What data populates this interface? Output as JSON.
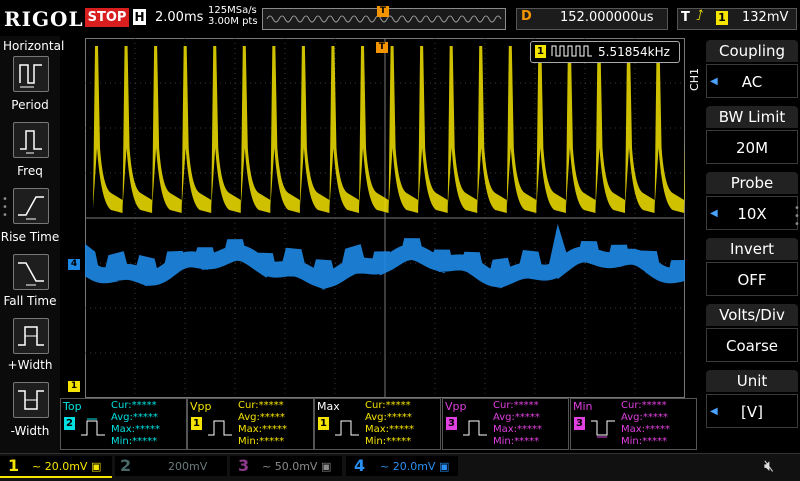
{
  "top": {
    "logo": "RIGOL",
    "status": "STOP",
    "h_badge": "H",
    "timebase": "2.00ms",
    "sample_rate": "125MSa/s",
    "mem_depth": "3.00M pts",
    "trigger_marker": "T",
    "d_badge": "D",
    "delay": "152.000000us",
    "t_badge": "T",
    "trigger_source": "1",
    "trigger_level": "132mV"
  },
  "left_panel": {
    "title": "Horizontal",
    "items": [
      {
        "label": "Period",
        "icon": "period-icon"
      },
      {
        "label": "Freq",
        "icon": "freq-icon"
      },
      {
        "label": "Rise Time",
        "icon": "rise-time-icon"
      },
      {
        "label": "Fall Time",
        "icon": "fall-time-icon"
      },
      {
        "label": "+Width",
        "icon": "plus-width-icon"
      },
      {
        "label": "-Width",
        "icon": "minus-width-icon"
      }
    ]
  },
  "right_menu": {
    "channel_label": "CH1",
    "items": [
      {
        "title": "Coupling",
        "value": "AC"
      },
      {
        "title": "BW Limit",
        "value": "20M"
      },
      {
        "title": "Probe",
        "value": "10X"
      },
      {
        "title": "Invert",
        "value": "OFF"
      },
      {
        "title": "Volts/Div",
        "value": "Coarse"
      },
      {
        "title": "Unit",
        "value": "[V]"
      }
    ]
  },
  "freq_counter": {
    "channel": "1",
    "value": "5.51854kHz"
  },
  "markers": {
    "ch4": "4",
    "ch1": "1",
    "trig": "T"
  },
  "measurements": [
    {
      "name": "Top",
      "channel": "2",
      "color": "#00e0e0",
      "cur": "Cur:*****",
      "avg": "Avg:*****",
      "max": "Max:*****",
      "min": "Min:*****"
    },
    {
      "name": "Vpp",
      "channel": "1",
      "color": "#f5e300",
      "cur": "Cur:*****",
      "avg": "Avg:*****",
      "max": "Max:*****",
      "min": "Min:*****"
    },
    {
      "name": "Max",
      "channel": "1",
      "color": "#f5e300",
      "cur": "Cur:*****",
      "avg": "Avg:*****",
      "max": "Max:*****",
      "min": "Min:*****"
    },
    {
      "name": "Vpp",
      "channel": "3",
      "color": "#e040e0",
      "cur": "Cur:*****",
      "avg": "Avg:*****",
      "max": "Max:*****",
      "min": "Min:*****"
    },
    {
      "name": "Min",
      "channel": "3",
      "color": "#e040e0",
      "cur": "Cur:*****",
      "avg": "Avg:*****",
      "max": "Max:*****",
      "min": "Min:*****"
    }
  ],
  "channels": [
    {
      "num": "1",
      "scale": "20.0mV",
      "color": "#f5e300"
    },
    {
      "num": "2",
      "scale": "200mV",
      "color": "#4a6a6a"
    },
    {
      "num": "3",
      "scale": "50.0mV",
      "color": "#8a3a8a"
    },
    {
      "num": "4",
      "scale": "20.0mV",
      "color": "#2a8ef0"
    }
  ],
  "colors": {
    "ch1": "#f5e300",
    "ch2": "#00e0e0",
    "ch3": "#e040e0",
    "ch4": "#1e88e5",
    "stop": "#d81e1e",
    "accent": "#f39400"
  }
}
